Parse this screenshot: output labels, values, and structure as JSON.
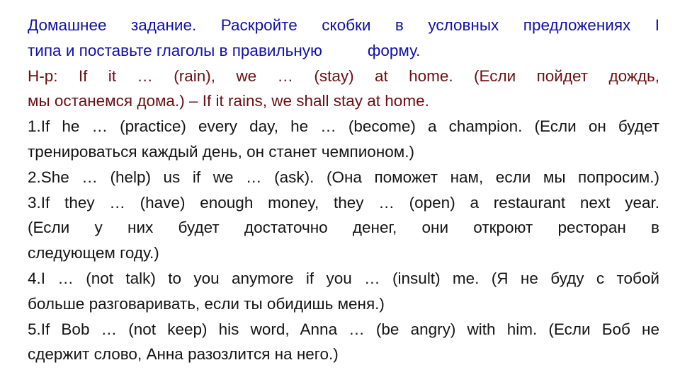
{
  "task": {
    "line1": "Домашнее задание. Раскройте скобки в условных предложениях I",
    "line2a": "типа и поставьте глаголы в правильную",
    "line2b": "форму."
  },
  "example": {
    "line1": "Н-р: If it … (rain), we … (stay) at home. (Если пойдет дождь,",
    "line2": "мы останемся дома.) – If it rains, we shall stay at home."
  },
  "exercises": [
    {
      "number": "1.",
      "lines": [
        "1.If he … (practice) every day, he … (become) a champion. (Если он будет",
        "тренироваться каждый день, он станет чемпионом.)"
      ]
    },
    {
      "number": "2.",
      "lines": [
        "2.She … (help) us if we … (ask). (Она поможет нам, если мы попросим.)"
      ]
    },
    {
      "number": "3.",
      "lines": [
        "3.If they … (have) enough money, they … (open) a restaurant next year.",
        "(Если у них будет достаточно денег, они откроют ресторан в",
        "следующем году.)"
      ]
    },
    {
      "number": "4.",
      "lines": [
        "4.I … (not talk) to you anymore if you … (insult) me. (Я не буду с тобой",
        "больше разговаривать, если ты обидишь меня.)"
      ]
    },
    {
      "number": "5.",
      "lines": [
        "5.If Bob … (not keep) his word, Anna … (be angry) with him. (Если Боб не",
        "сдержит слово, Анна разозлится на него.)"
      ]
    }
  ],
  "colors": {
    "task": "#1010a8",
    "example": "#6a0f12",
    "exercises": "#141414"
  }
}
